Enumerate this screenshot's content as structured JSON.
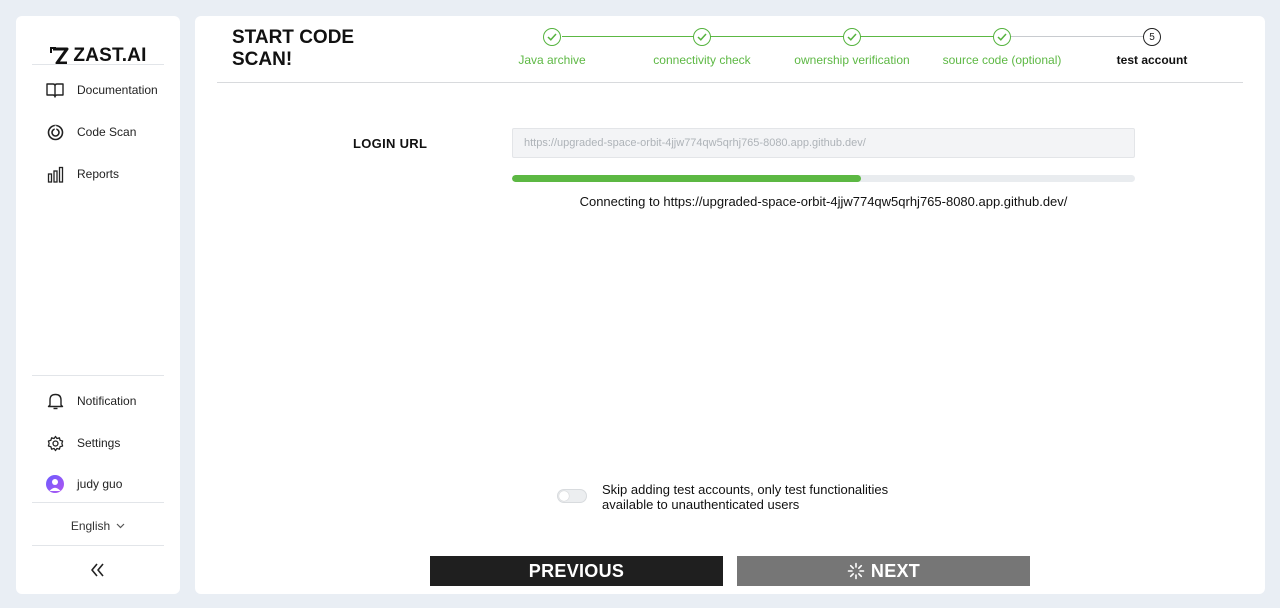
{
  "brand": {
    "name": "ZAST.AI"
  },
  "sidebar": {
    "nav": [
      {
        "label": "Documentation",
        "icon": "book-icon"
      },
      {
        "label": "Code Scan",
        "icon": "scan-icon"
      },
      {
        "label": "Reports",
        "icon": "bar-chart-icon"
      }
    ],
    "bottom": [
      {
        "label": "Notification",
        "icon": "bell-icon"
      },
      {
        "label": "Settings",
        "icon": "gear-icon"
      }
    ],
    "user": {
      "name": "judy guo",
      "icon": "avatar-icon"
    },
    "language": "English",
    "collapse_icon": "double-chevron-left-icon"
  },
  "main": {
    "title": "START CODE SCAN!",
    "steps": [
      {
        "label": "Java archive",
        "status": "done"
      },
      {
        "label": "connectivity check",
        "status": "done"
      },
      {
        "label": "ownership verification",
        "status": "done"
      },
      {
        "label": "source code (optional)",
        "status": "done"
      },
      {
        "label": "test account",
        "status": "current",
        "number": "5"
      }
    ],
    "login": {
      "label": "LOGIN URL",
      "placeholder": "https://upgraded-space-orbit-4jjw774qw5qrhj765-8080.app.github.dev/"
    },
    "progress": {
      "percent": 56
    },
    "status_text": "Connecting to https://upgraded-space-orbit-4jjw774qw5qrhj765-8080.app.github.dev/",
    "skip": {
      "enabled": false,
      "text": "Skip adding test accounts, only test functionalities available to unauthenticated users"
    },
    "buttons": {
      "previous": "PREVIOUS",
      "next": "NEXT"
    }
  },
  "colors": {
    "accent": "#5cb843",
    "dark_button": "#1f1f1f",
    "disabled_button": "#767676"
  }
}
